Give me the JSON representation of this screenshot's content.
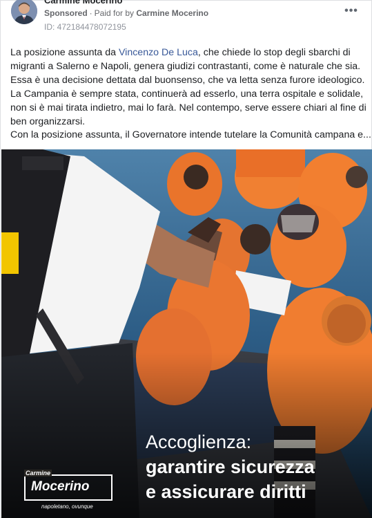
{
  "post": {
    "author": "Carmine Mocerino",
    "sponsored_label": "Sponsored",
    "paid_for_label": "Paid for by",
    "payer": "Carmine Mocerino",
    "ad_id": "ID: 472184478072195",
    "more_label": "•••"
  },
  "text": {
    "line1_a": "La posizione assunta da ",
    "line1_link": "Vincenzo De Luca",
    "line1_b": ", che chiede lo stop degli sbarchi di",
    "line2": "migranti a Salerno e Napoli, genera giudizi contrastanti, come è naturale che sia.",
    "line3": "Essa è una decisione dettata dal buonsenso, che va letta senza furore ideologico.",
    "line4": "La Campania è sempre stata, continuerà ad esserlo, una terra ospitale e solidale,",
    "line5": "non si è mai tirata indietro, mai lo farà. Nel contempo, serve essere chiari al fine di",
    "line6": "ben organizzarsi.",
    "line7": "Con la posizione assunta, il Governatore intende tutelare la Comunità campana e..."
  },
  "image": {
    "headline": "Accoglienza:",
    "line1": "garantire sicurezza",
    "line2": "e assicurare diritti",
    "brand_small": "Carmine",
    "brand_name": "Mocerino",
    "brand_sub": "napoletano, ovunque"
  },
  "colors": {
    "link": "#385898",
    "vest": "#f07a2f",
    "sea": "#2f5e86"
  }
}
